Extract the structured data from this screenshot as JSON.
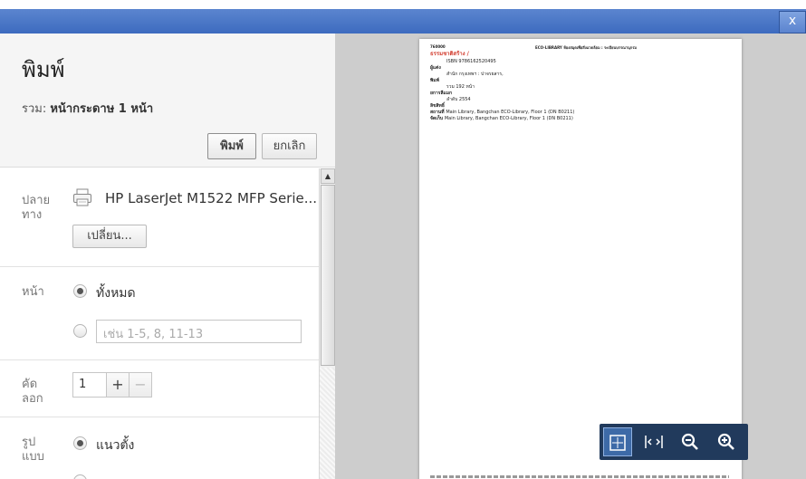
{
  "window": {
    "close_glyph": "x"
  },
  "header": {
    "title": "พิมพ์",
    "summary_prefix": "รวม:",
    "summary_value": "หน้ากระดาษ 1 หน้า",
    "print_label": "พิมพ์",
    "cancel_label": "ยกเลิก"
  },
  "destination": {
    "label": "ปลายทาง",
    "printer_name": "HP LaserJet M1522 MFP Serie...",
    "change_label": "เปลี่ยน...",
    "icon": "printer-icon"
  },
  "pages": {
    "label": "หน้า",
    "all_label": "ทั้งหมด",
    "all_selected": true,
    "range_placeholder": "เช่น 1-5, 8, 11-13"
  },
  "copies": {
    "label": "คัดลอก",
    "value": "1",
    "plus": "+",
    "minus": "−"
  },
  "layout": {
    "label": "รูปแบบ",
    "portrait_label": "แนวตั้ง",
    "portrait_selected": true
  },
  "preview": {
    "header_left": "760000",
    "header_right": "ECO-LIBRARY ห้องสมุดเพื่อสิ่งแวดล้อม : ระเบียนบรรณานุกรม",
    "title": "ธรรมชาติสร้าง /",
    "lines": [
      {
        "key": "",
        "value": "ISBN 9786162520495"
      },
      {
        "key": "ผู้แต่ง",
        "value": ""
      },
      {
        "key": "",
        "value": "สำนัก กรุงเทพฯ : ปาจรยสาร,"
      },
      {
        "key": "พิมพ์",
        "value": ""
      },
      {
        "key": "",
        "value": "รวม 192 หน้า"
      },
      {
        "key": "ยการลีแมก",
        "value": ""
      },
      {
        "key": "",
        "value": "ลำดับ 2554"
      },
      {
        "key": "ลิขสิทธิ์",
        "value": ""
      },
      {
        "key": "สถานที่",
        "value": "Main Library, Bangchan ECO-Library, Floor 1 (DN B0211)"
      },
      {
        "key": "จัดเก็บ",
        "value": "Main Library, Bangchan ECO-Library, Floor 1 (DN B0211)"
      }
    ]
  },
  "zoom_controls": {
    "fit_icon": "fit-page-icon",
    "fit_width_icon": "fit-width-icon",
    "zoom_out_icon": "zoom-out-icon",
    "zoom_in_icon": "zoom-in-icon"
  },
  "colors": {
    "title_bar": "#4a78c8",
    "zoom_bar": "#213a5c",
    "preview_bg": "#cdcdcd",
    "record_title": "#d23d2f"
  }
}
